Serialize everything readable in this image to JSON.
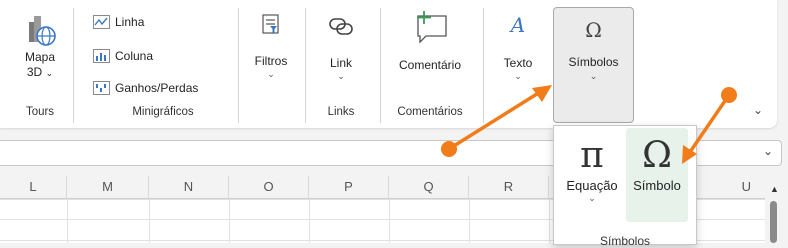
{
  "ribbon": {
    "tours": {
      "button": "Mapa",
      "sub": "3D",
      "group": "Tours"
    },
    "sparklines": {
      "items": [
        "Linha",
        "Coluna",
        "Ganhos/Perdas"
      ],
      "group": "Minigráficos"
    },
    "filters": {
      "button": "Filtros"
    },
    "links": {
      "button": "Link",
      "group": "Links"
    },
    "comments": {
      "button": "Comentário",
      "group": "Comentários"
    },
    "text": {
      "button": "Texto"
    },
    "symbols": {
      "button": "Símbolos"
    }
  },
  "columns": [
    "L",
    "M",
    "N",
    "O",
    "P",
    "Q",
    "R",
    "U"
  ],
  "dropdown": {
    "items": [
      {
        "glyph": "π",
        "label": "Equação"
      },
      {
        "glyph": "Ω",
        "label": "Símbolo"
      }
    ],
    "group": "Símbolos"
  },
  "colors": {
    "arrow": "#f07c1a",
    "accent": "#4a7dbd",
    "highlight": "#e6f2ea"
  }
}
